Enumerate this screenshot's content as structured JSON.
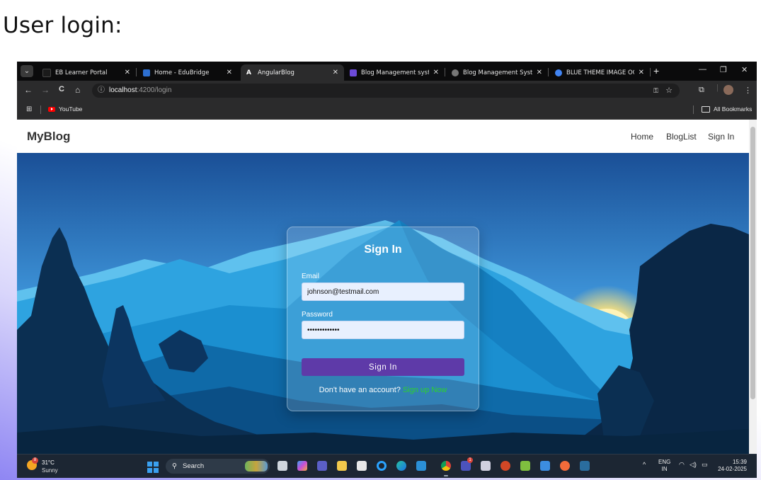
{
  "slide": {
    "title": "User login:"
  },
  "browser": {
    "tabs": [
      {
        "label": "EB Learner Portal",
        "favicon_color": "#1b1b1b",
        "close": "✕"
      },
      {
        "label": "Home - EduBridge",
        "favicon_color": "#2d6fd1",
        "close": "✕"
      },
      {
        "label": "AngularBlog",
        "favicon_color": "#dd0031",
        "favicon_text": "A",
        "close": "✕"
      },
      {
        "label": "Blog Management system",
        "favicon_color": "#6c4ad8",
        "close": "✕"
      },
      {
        "label": "Blog Management System",
        "favicon_color": "#777777",
        "close": "✕"
      },
      {
        "label": "BLUE THEME IMAGE OG H",
        "favicon_color": "#4285f4",
        "close": "✕"
      }
    ],
    "new_tab": "+",
    "window_controls": {
      "minimize": "—",
      "restore": "❐",
      "close": "✕"
    },
    "nav": {
      "back": "←",
      "forward": "→",
      "reload": "C",
      "home": "⌂"
    },
    "address": {
      "host": "localhost",
      "path": ":4200/login"
    },
    "bookmarks": [
      {
        "label": "YouTube"
      }
    ],
    "all_bookmarks": "All Bookmarks"
  },
  "app": {
    "brand": "MyBlog",
    "nav_links": [
      "Home",
      "BlogList",
      "Sign In"
    ]
  },
  "login": {
    "title": "Sign In",
    "email_label": "Email",
    "email_value": "johnson@testmail.com",
    "password_label": "Password",
    "password_value": "•••••••••••••",
    "submit_label": "Sign In",
    "signup_prompt": "Don't have an account?",
    "signup_link": "Sign up Now"
  },
  "taskbar": {
    "weather_temp": "31°C",
    "weather_desc": "Sunny",
    "weather_badge": "8",
    "search_label": "Search",
    "teams_badge": "1",
    "lang_line1": "ENG",
    "lang_line2": "IN",
    "time": "15:39",
    "date": "24-02-2025"
  },
  "colors": {
    "accent_button": "#5e3aa8",
    "signup_link": "#2cd32c",
    "sky_top": "#1a4f96",
    "sky_bottom": "#6fd0f3"
  }
}
